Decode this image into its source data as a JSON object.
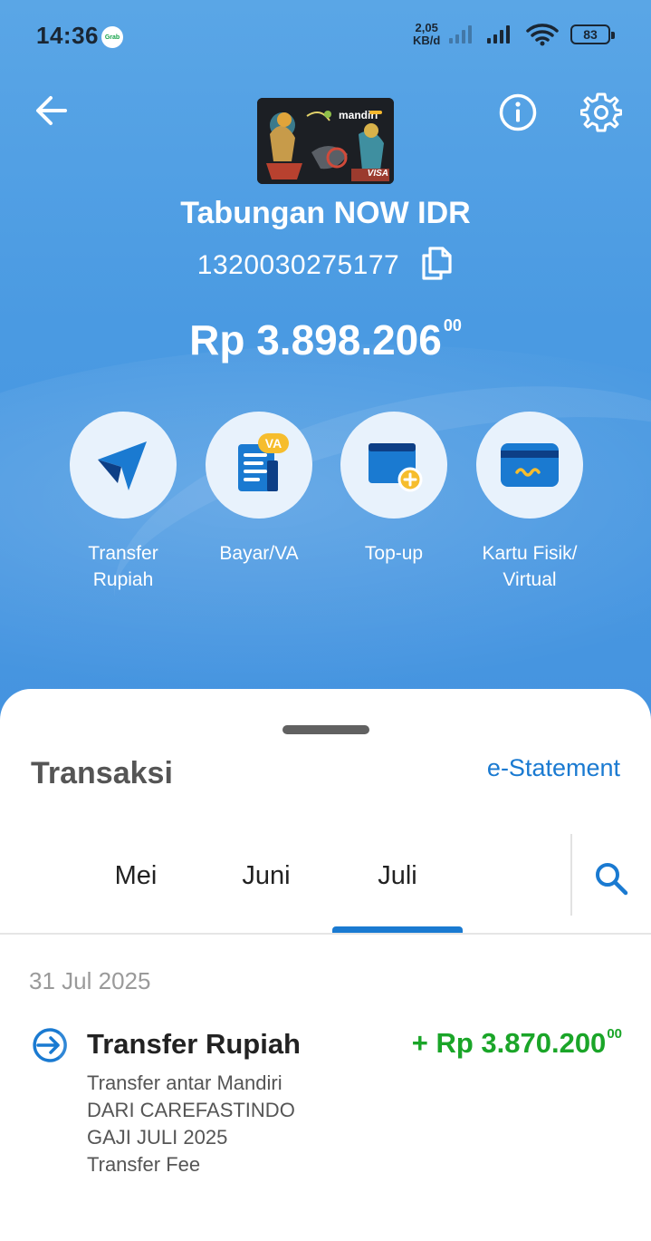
{
  "status_bar": {
    "time": "14:36",
    "notification_app": "Grab",
    "net_speed_value": "2,05",
    "net_speed_unit": "KB/d",
    "battery": "83"
  },
  "header": {
    "back_icon": "arrow-left-icon",
    "info_icon": "info-circle-icon",
    "settings_icon": "gear-icon",
    "card_brand": "mandiri",
    "card_network": "VISA"
  },
  "account": {
    "name": "Tabungan NOW IDR",
    "number": "1320030275177",
    "copy_icon": "copy-icon",
    "balance_main": "Rp 3.898.206",
    "balance_cents": "00"
  },
  "actions": [
    {
      "label_line1": "Transfer",
      "label_line2": "Rupiah",
      "icon": "send-icon"
    },
    {
      "label_line1": "Bayar/VA",
      "label_line2": "",
      "icon": "bill-va-icon",
      "badge": "VA"
    },
    {
      "label_line1": "Top-up",
      "label_line2": "",
      "icon": "wallet-plus-icon"
    },
    {
      "label_line1": "Kartu Fisik/",
      "label_line2": "Virtual",
      "icon": "card-icon"
    }
  ],
  "transactions_section": {
    "title": "Transaksi",
    "e_statement_link": "e-Statement",
    "tabs": [
      "Mei",
      "Juni",
      "Juli"
    ],
    "active_tab": "Juli",
    "search_icon": "search-icon"
  },
  "transactions": [
    {
      "date": "31 Jul 2025",
      "title": "Transfer Rupiah",
      "amount_main": "+ Rp 3.870.200",
      "amount_cents": "00",
      "details": [
        "Transfer antar Mandiri",
        "DARI CAREFASTINDO",
        "GAJI JULI 2025",
        "Transfer Fee"
      ]
    }
  ],
  "colors": {
    "hero_blue": "#4a9ae2",
    "accent_blue": "#1a7ad1",
    "credit_green": "#1aa528"
  }
}
